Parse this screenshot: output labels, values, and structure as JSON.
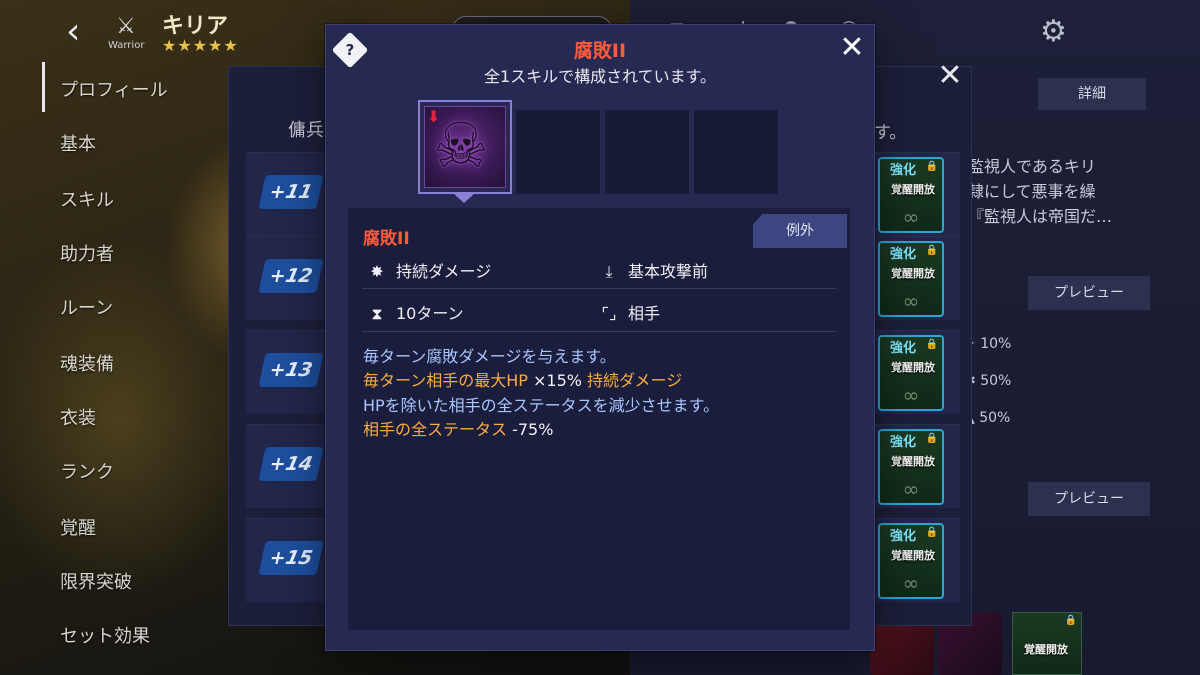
{
  "header": {
    "back_icon": "‹",
    "class_label": "Warrior",
    "character_name": "キリア",
    "stars": "★★★★★"
  },
  "side_menu": {
    "items": [
      {
        "label": "プロフィール"
      },
      {
        "label": "基本"
      },
      {
        "label": "スキル"
      },
      {
        "label": "助力者"
      },
      {
        "label": "ルーン"
      },
      {
        "label": "魂装備"
      },
      {
        "label": "衣装"
      },
      {
        "label": "ランク"
      },
      {
        "label": "覚醒"
      },
      {
        "label": "限界突破"
      },
      {
        "label": "セット効果"
      }
    ]
  },
  "mid_panel": {
    "header_text": "傭兵",
    "header_tail": "す。",
    "rows": [
      {
        "level": "+11",
        "evo_label": "強化",
        "evo_sub": "覚醒開放"
      },
      {
        "level": "+12",
        "evo_label": "強化",
        "evo_sub": "覚醒開放"
      },
      {
        "level": "+13",
        "evo_label": "強化",
        "evo_sub": "覚醒開放"
      },
      {
        "level": "+14",
        "evo_label": "強化",
        "evo_sub": "覚醒開放"
      },
      {
        "level": "+15",
        "evo_label": "強化",
        "evo_sub": "覚醒開放"
      }
    ]
  },
  "right_panel": {
    "detail_tab": "詳細",
    "lore_lines": [
      "監視人であるキリ",
      "隷にして悪事を繰",
      "『監視人は帝国だ…"
    ],
    "preview_tab_1": "プレビュー",
    "preview_tab_2": "プレビュー",
    "stats": [
      "10%",
      "50%",
      "50%"
    ],
    "bottom_evo_sub": "覚醒開放"
  },
  "popup": {
    "help_icon": "?",
    "title": "腐敗II",
    "subtitle": "全1スキルで構成されています。",
    "close_icon": "✕",
    "skill": {
      "name": "腐敗II",
      "tag": "例外",
      "type_label": "持続ダメージ",
      "timing_label": "基本攻撃前",
      "duration_label": "10ターン",
      "target_label": "相手",
      "desc_line1": "毎ターン腐敗ダメージを与えます。",
      "desc_line2_a": "毎ターン相手の最大HP",
      "desc_line2_b": " ×15% ",
      "desc_line2_c": "持続ダメージ",
      "desc_line3": "HPを除いた相手の全ステータスを減少させます。",
      "desc_line4_a": "相手の全ステータス",
      "desc_line4_b": " -75%"
    }
  },
  "colors": {
    "title_red": "#ff5a3c",
    "highlight_orange": "#ffab3d",
    "text_blue": "#a9c6ff",
    "panel": "#262a52",
    "evo_border": "#2aa6d8"
  }
}
